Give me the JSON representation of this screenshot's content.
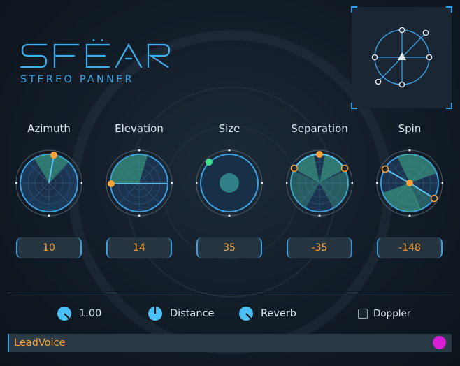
{
  "header": {
    "logo_text": "SFËAR",
    "subtitle": "STEREO PANNER"
  },
  "knobs": [
    {
      "id": "azimuth",
      "label": "Azimuth",
      "value": "10"
    },
    {
      "id": "elevation",
      "label": "Elevation",
      "value": "14"
    },
    {
      "id": "size",
      "label": "Size",
      "value": "35"
    },
    {
      "id": "separation",
      "label": "Separation",
      "value": "-35"
    },
    {
      "id": "spin",
      "label": "Spin",
      "value": "-148"
    }
  ],
  "footer": {
    "gain_value": "1.00",
    "distance_label": "Distance",
    "reverb_label": "Reverb",
    "doppler_label": "Doppler",
    "doppler_checked": false
  },
  "track": {
    "name": "LeadVoice",
    "color": "#d81fd4"
  },
  "colors": {
    "accent": "#3a9fe0",
    "value_orange": "#f5a33a",
    "handle_green": "#3fe08a"
  }
}
